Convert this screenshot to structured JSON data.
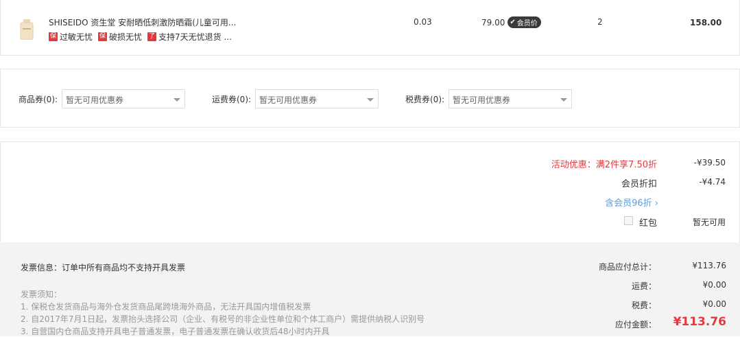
{
  "product": {
    "name": "SHISEIDO 资生堂 安耐晒低刺激防晒霜(儿童可用...",
    "tags": [
      {
        "badge": "保",
        "text": "过敏无忧"
      },
      {
        "badge": "保",
        "text": "破损无忧"
      },
      {
        "badge": "了",
        "text": "支持7天无忧退货 ..."
      }
    ],
    "weight": "0.03",
    "price": "79.00",
    "member_badge": "会员价",
    "quantity": "2",
    "subtotal": "158.00"
  },
  "coupons": [
    {
      "label": "商品券(0):",
      "placeholder": "暂无可用优惠券"
    },
    {
      "label": "运费券(0):",
      "placeholder": "暂无可用优惠券"
    },
    {
      "label": "税费券(0):",
      "placeholder": "暂无可用优惠券"
    }
  ],
  "discounts": {
    "activity_label": "活动优惠：满2件享7.50折",
    "activity_value": "-¥39.50",
    "member_label": "会员折扣",
    "member_value": "-¥4.74",
    "member_link": "含会员96折",
    "redpacket_label": "红包",
    "redpacket_value": "暂无可用"
  },
  "invoice": {
    "info": "发票信息：订单中所有商品均不支持开具发票",
    "notice_title": "发票须知：",
    "notes": [
      "1. 保税仓发货商品与海外仓发货商品尾跨境海外商品，无法开具国内增值税发票",
      "2. 自2017年7月1日起，发票抬头选择公司（企业、有税号的非企业性单位和个体工商户）需提供纳税人识别号",
      "3. 自营国内仓商品支持开具电子普通发票，电子普通发票在确认收货后48小时内开具"
    ]
  },
  "totals": {
    "goods_label": "商品应付总计：",
    "goods_value": "¥113.76",
    "shipping_label": "运费：",
    "shipping_value": "¥0.00",
    "tax_label": "税费：",
    "tax_value": "¥0.00",
    "payable_label": "应付金额：",
    "payable_value": "¥113.76"
  },
  "colors": {
    "accent_red": "#e4393c",
    "link_blue": "#5e9ddb"
  }
}
